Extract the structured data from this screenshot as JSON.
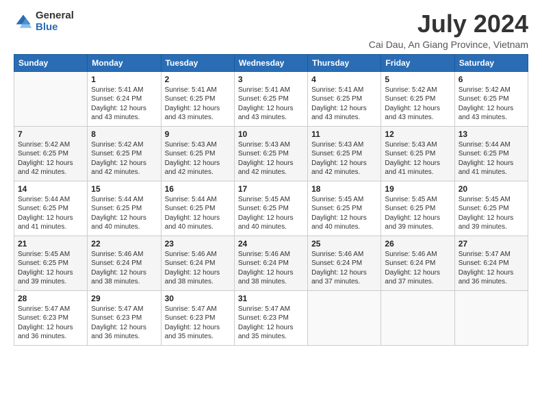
{
  "logo": {
    "general": "General",
    "blue": "Blue"
  },
  "header": {
    "title": "July 2024",
    "subtitle": "Cai Dau, An Giang Province, Vietnam"
  },
  "days_of_week": [
    "Sunday",
    "Monday",
    "Tuesday",
    "Wednesday",
    "Thursday",
    "Friday",
    "Saturday"
  ],
  "weeks": [
    [
      {
        "num": "",
        "info": ""
      },
      {
        "num": "1",
        "info": "Sunrise: 5:41 AM\nSunset: 6:24 PM\nDaylight: 12 hours\nand 43 minutes."
      },
      {
        "num": "2",
        "info": "Sunrise: 5:41 AM\nSunset: 6:25 PM\nDaylight: 12 hours\nand 43 minutes."
      },
      {
        "num": "3",
        "info": "Sunrise: 5:41 AM\nSunset: 6:25 PM\nDaylight: 12 hours\nand 43 minutes."
      },
      {
        "num": "4",
        "info": "Sunrise: 5:41 AM\nSunset: 6:25 PM\nDaylight: 12 hours\nand 43 minutes."
      },
      {
        "num": "5",
        "info": "Sunrise: 5:42 AM\nSunset: 6:25 PM\nDaylight: 12 hours\nand 43 minutes."
      },
      {
        "num": "6",
        "info": "Sunrise: 5:42 AM\nSunset: 6:25 PM\nDaylight: 12 hours\nand 43 minutes."
      }
    ],
    [
      {
        "num": "7",
        "info": "Sunrise: 5:42 AM\nSunset: 6:25 PM\nDaylight: 12 hours\nand 42 minutes."
      },
      {
        "num": "8",
        "info": "Sunrise: 5:42 AM\nSunset: 6:25 PM\nDaylight: 12 hours\nand 42 minutes."
      },
      {
        "num": "9",
        "info": "Sunrise: 5:43 AM\nSunset: 6:25 PM\nDaylight: 12 hours\nand 42 minutes."
      },
      {
        "num": "10",
        "info": "Sunrise: 5:43 AM\nSunset: 6:25 PM\nDaylight: 12 hours\nand 42 minutes."
      },
      {
        "num": "11",
        "info": "Sunrise: 5:43 AM\nSunset: 6:25 PM\nDaylight: 12 hours\nand 42 minutes."
      },
      {
        "num": "12",
        "info": "Sunrise: 5:43 AM\nSunset: 6:25 PM\nDaylight: 12 hours\nand 41 minutes."
      },
      {
        "num": "13",
        "info": "Sunrise: 5:44 AM\nSunset: 6:25 PM\nDaylight: 12 hours\nand 41 minutes."
      }
    ],
    [
      {
        "num": "14",
        "info": "Sunrise: 5:44 AM\nSunset: 6:25 PM\nDaylight: 12 hours\nand 41 minutes."
      },
      {
        "num": "15",
        "info": "Sunrise: 5:44 AM\nSunset: 6:25 PM\nDaylight: 12 hours\nand 40 minutes."
      },
      {
        "num": "16",
        "info": "Sunrise: 5:44 AM\nSunset: 6:25 PM\nDaylight: 12 hours\nand 40 minutes."
      },
      {
        "num": "17",
        "info": "Sunrise: 5:45 AM\nSunset: 6:25 PM\nDaylight: 12 hours\nand 40 minutes."
      },
      {
        "num": "18",
        "info": "Sunrise: 5:45 AM\nSunset: 6:25 PM\nDaylight: 12 hours\nand 40 minutes."
      },
      {
        "num": "19",
        "info": "Sunrise: 5:45 AM\nSunset: 6:25 PM\nDaylight: 12 hours\nand 39 minutes."
      },
      {
        "num": "20",
        "info": "Sunrise: 5:45 AM\nSunset: 6:25 PM\nDaylight: 12 hours\nand 39 minutes."
      }
    ],
    [
      {
        "num": "21",
        "info": "Sunrise: 5:45 AM\nSunset: 6:25 PM\nDaylight: 12 hours\nand 39 minutes."
      },
      {
        "num": "22",
        "info": "Sunrise: 5:46 AM\nSunset: 6:24 PM\nDaylight: 12 hours\nand 38 minutes."
      },
      {
        "num": "23",
        "info": "Sunrise: 5:46 AM\nSunset: 6:24 PM\nDaylight: 12 hours\nand 38 minutes."
      },
      {
        "num": "24",
        "info": "Sunrise: 5:46 AM\nSunset: 6:24 PM\nDaylight: 12 hours\nand 38 minutes."
      },
      {
        "num": "25",
        "info": "Sunrise: 5:46 AM\nSunset: 6:24 PM\nDaylight: 12 hours\nand 37 minutes."
      },
      {
        "num": "26",
        "info": "Sunrise: 5:46 AM\nSunset: 6:24 PM\nDaylight: 12 hours\nand 37 minutes."
      },
      {
        "num": "27",
        "info": "Sunrise: 5:47 AM\nSunset: 6:24 PM\nDaylight: 12 hours\nand 36 minutes."
      }
    ],
    [
      {
        "num": "28",
        "info": "Sunrise: 5:47 AM\nSunset: 6:23 PM\nDaylight: 12 hours\nand 36 minutes."
      },
      {
        "num": "29",
        "info": "Sunrise: 5:47 AM\nSunset: 6:23 PM\nDaylight: 12 hours\nand 36 minutes."
      },
      {
        "num": "30",
        "info": "Sunrise: 5:47 AM\nSunset: 6:23 PM\nDaylight: 12 hours\nand 35 minutes."
      },
      {
        "num": "31",
        "info": "Sunrise: 5:47 AM\nSunset: 6:23 PM\nDaylight: 12 hours\nand 35 minutes."
      },
      {
        "num": "",
        "info": ""
      },
      {
        "num": "",
        "info": ""
      },
      {
        "num": "",
        "info": ""
      }
    ]
  ]
}
